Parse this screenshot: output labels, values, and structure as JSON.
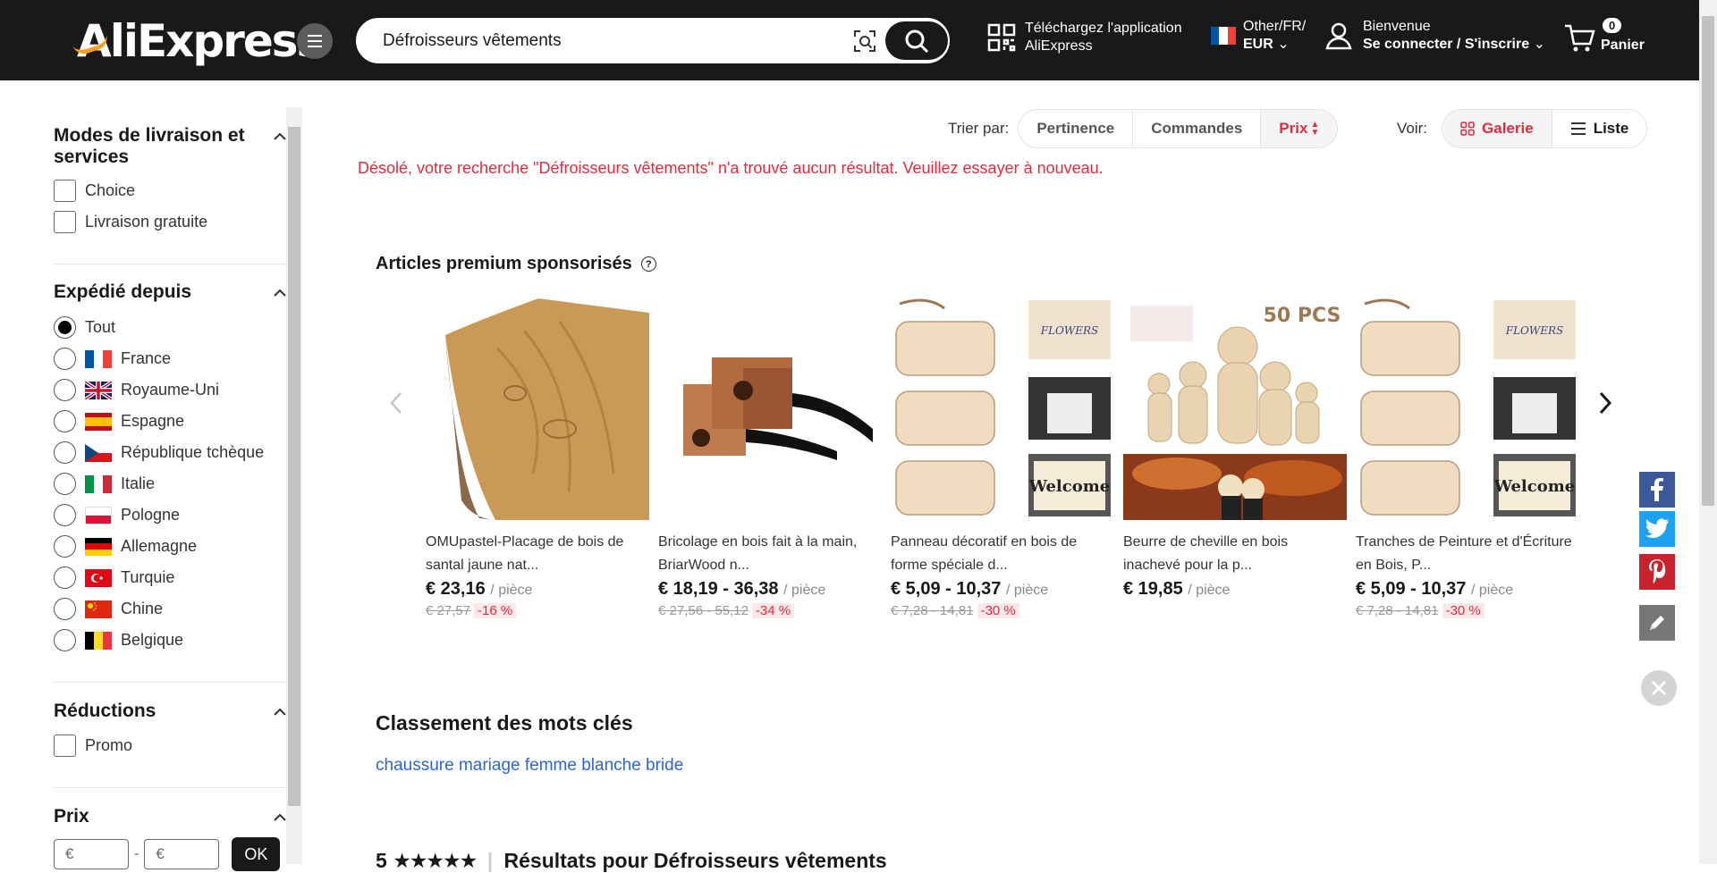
{
  "header": {
    "logo": "AliExpress",
    "search_value": "Défroisseurs vêtements",
    "app_line1": "Téléchargez l'application",
    "app_line2": "AliExpress",
    "lang_line1": "Other/FR/",
    "lang_line2": "EUR",
    "account_line1": "Bienvenue",
    "account_line2": "Se connecter / S'inscrire",
    "cart_count": "0",
    "cart_label": "Panier"
  },
  "filters": {
    "delivery": {
      "title": "Modes de livraison et services",
      "options": [
        "Choice",
        "Livraison gratuite"
      ]
    },
    "ship_from": {
      "title": "Expédié depuis",
      "options": [
        "Tout",
        "France",
        "Royaume-Uni",
        "Espagne",
        "République tchèque",
        "Italie",
        "Pologne",
        "Allemagne",
        "Turquie",
        "Chine",
        "Belgique"
      ],
      "selected": "Tout"
    },
    "discounts": {
      "title": "Réductions",
      "options": [
        "Promo"
      ]
    },
    "price": {
      "title": "Prix",
      "min_placeholder": "€",
      "max_placeholder": "€",
      "ok": "OK",
      "separator": "-"
    }
  },
  "sort": {
    "label": "Trier par:",
    "options": [
      "Pertinence",
      "Commandes",
      "Prix"
    ],
    "active": "Prix",
    "view_label": "Voir:",
    "view_options": [
      "Galerie",
      "Liste"
    ],
    "view_active": "Galerie"
  },
  "no_result": "Désolé, votre recherche \"Défroisseurs vêtements\" n'a trouvé aucun résultat. Veuillez essayer à nouveau.",
  "premium": {
    "title": "Articles premium sponsorisés",
    "items": [
      {
        "title": "OMUpastel-Placage de bois de santal jaune nat...",
        "price": "€ 23,16",
        "unit": "/ pièce",
        "orig": "€ 27,57",
        "disc": "-16 %"
      },
      {
        "title": "Bricolage en bois fait à la main, BriarWood n...",
        "price": "€ 18,19 - 36,38",
        "unit": "/ pièce",
        "orig": "€ 27,56 - 55,12",
        "disc": "-34 %"
      },
      {
        "title": "Panneau décoratif en bois de forme spéciale d...",
        "price": "€ 5,09 - 10,37",
        "unit": "/ pièce",
        "orig": "€ 7,28 - 14,81",
        "disc": "-30 %"
      },
      {
        "title": "Beurre de cheville en bois inachevé pour la p...",
        "price": "€ 19,85",
        "unit": "/ pièce",
        "orig": "",
        "disc": ""
      },
      {
        "title": "Tranches de Peinture et d'Écriture en Bois, P...",
        "price": "€ 5,09 - 10,37",
        "unit": "/ pièce",
        "orig": "€ 7,28 - 14,81",
        "disc": "-30 %"
      }
    ],
    "image_text_50pcs": "50 PCS",
    "image_text_welcome": "Welcome"
  },
  "keywords": {
    "title": "Classement des mots clés",
    "link": "chaussure mariage femme blanche bride"
  },
  "results_line": "Résultats pour Défroisseurs vêtements",
  "colors": {
    "accent": "#e42b3e",
    "header_bg": "#191919",
    "link": "#2e64d6"
  }
}
